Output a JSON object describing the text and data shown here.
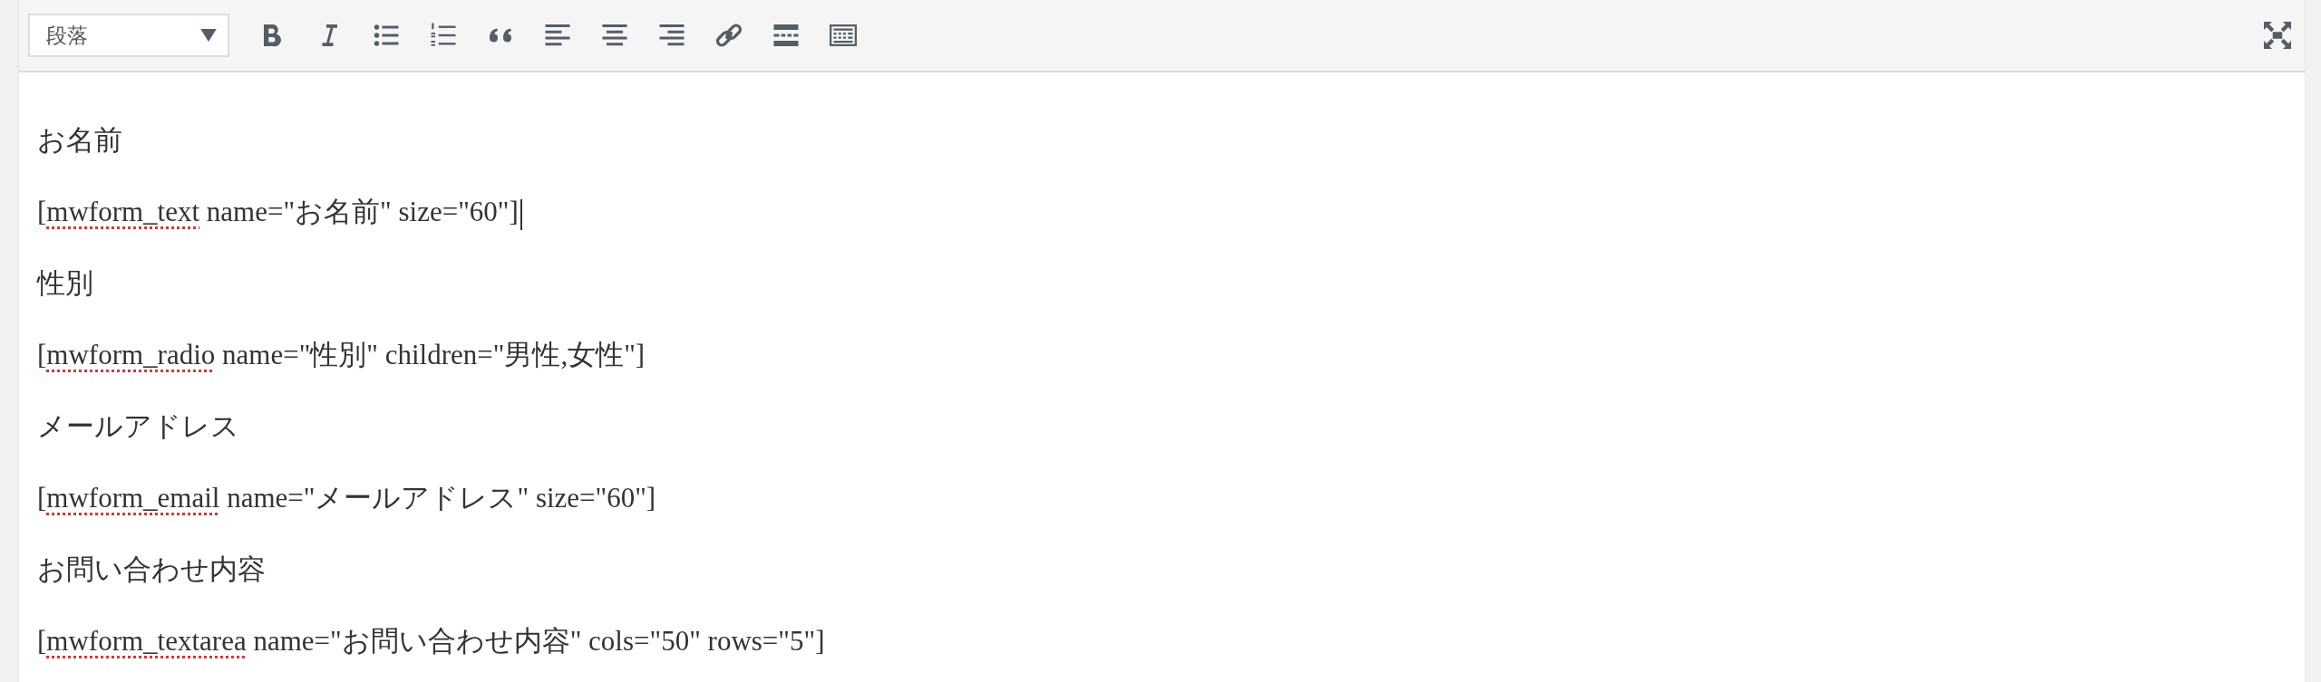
{
  "toolbar": {
    "format_dropdown": {
      "value": "段落"
    },
    "buttons": [
      {
        "kind": "bold"
      },
      {
        "kind": "italic"
      },
      {
        "kind": "bullet-list"
      },
      {
        "kind": "numbered-list"
      },
      {
        "kind": "quote"
      },
      {
        "kind": "align-left"
      },
      {
        "kind": "align-center"
      },
      {
        "kind": "align-right"
      },
      {
        "kind": "link"
      },
      {
        "kind": "read-more"
      },
      {
        "kind": "toolbar-toggle"
      }
    ],
    "fullscreen_button": {
      "kind": "fullscreen"
    }
  },
  "content": {
    "paragraphs": [
      {
        "parts": [
          {
            "text": "お名前",
            "flagged": false
          }
        ],
        "caret": false
      },
      {
        "parts": [
          {
            "text": "[",
            "flagged": false
          },
          {
            "text": "mwform_text",
            "flagged": true
          },
          {
            "text": " name=\"お名前\" size=\"60\"]",
            "flagged": false
          }
        ],
        "caret": true
      },
      {
        "parts": [
          {
            "text": "性別",
            "flagged": false
          }
        ],
        "caret": false
      },
      {
        "parts": [
          {
            "text": "[",
            "flagged": false
          },
          {
            "text": "mwform_radio",
            "flagged": true
          },
          {
            "text": " name=\"性別\" children=\"男性,女性\"]",
            "flagged": false
          }
        ],
        "caret": false
      },
      {
        "parts": [
          {
            "text": "メールアドレス",
            "flagged": false
          }
        ],
        "caret": false
      },
      {
        "parts": [
          {
            "text": "[",
            "flagged": false
          },
          {
            "text": "mwform_email",
            "flagged": true
          },
          {
            "text": " name=\"メールアドレス\" size=\"60\"]",
            "flagged": false
          }
        ],
        "caret": false
      },
      {
        "parts": [
          {
            "text": "お問い合わせ内容",
            "flagged": false
          }
        ],
        "caret": false
      },
      {
        "parts": [
          {
            "text": "[",
            "flagged": false
          },
          {
            "text": "mwform_textarea",
            "flagged": true
          },
          {
            "text": " name=\"お問い合わせ内容\" cols=\"50\" rows=\"5\"]",
            "flagged": false
          }
        ],
        "caret": false
      }
    ]
  }
}
